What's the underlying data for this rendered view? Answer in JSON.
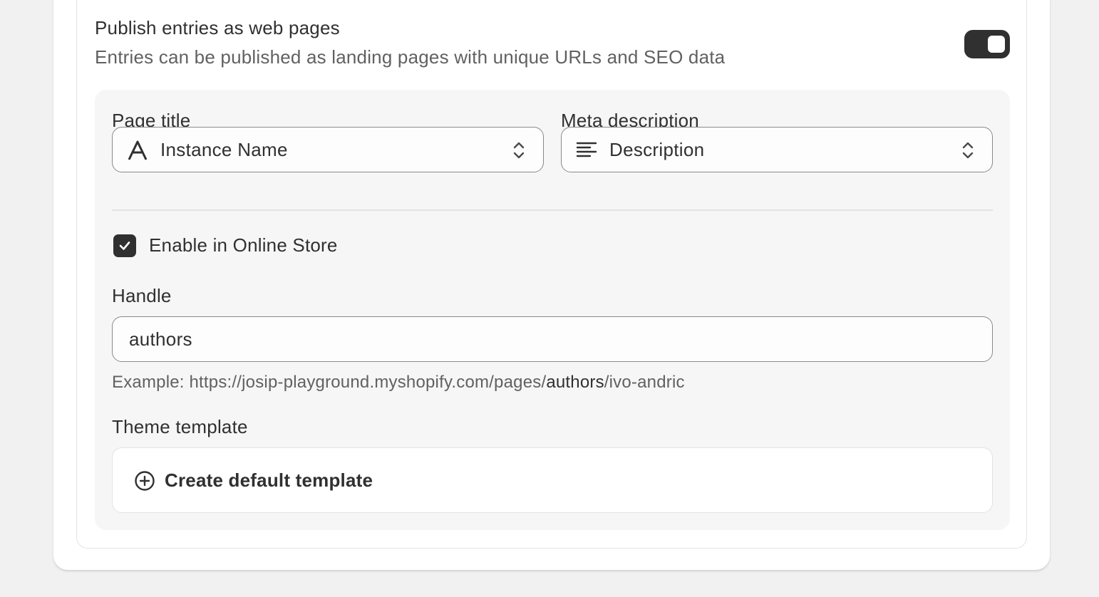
{
  "publish": {
    "title": "Publish entries as web pages",
    "description": "Entries can be published as landing pages with unique URLs and SEO data",
    "toggle_on": true
  },
  "page_title": {
    "label": "Page title",
    "value": "Instance Name",
    "icon": "text-type-icon"
  },
  "meta_description": {
    "label": "Meta description",
    "value": "Description",
    "icon": "text-lines-icon"
  },
  "online_store": {
    "checked": true,
    "label": "Enable in Online Store"
  },
  "handle": {
    "label": "Handle",
    "value": "authors",
    "example_prefix": "Example: https://josip-playground.myshopify.com/pages/",
    "example_handle": "authors",
    "example_suffix": "/ivo-andric"
  },
  "theme_template": {
    "label": "Theme template",
    "button_label": "Create default template",
    "icon": "plus-circle-icon"
  },
  "colors": {
    "text": "#303030",
    "subdued_text": "#616161",
    "toggle_on": "#303030",
    "panel_bg": "#f6f6f6",
    "page_bg": "#f1f1f1"
  }
}
